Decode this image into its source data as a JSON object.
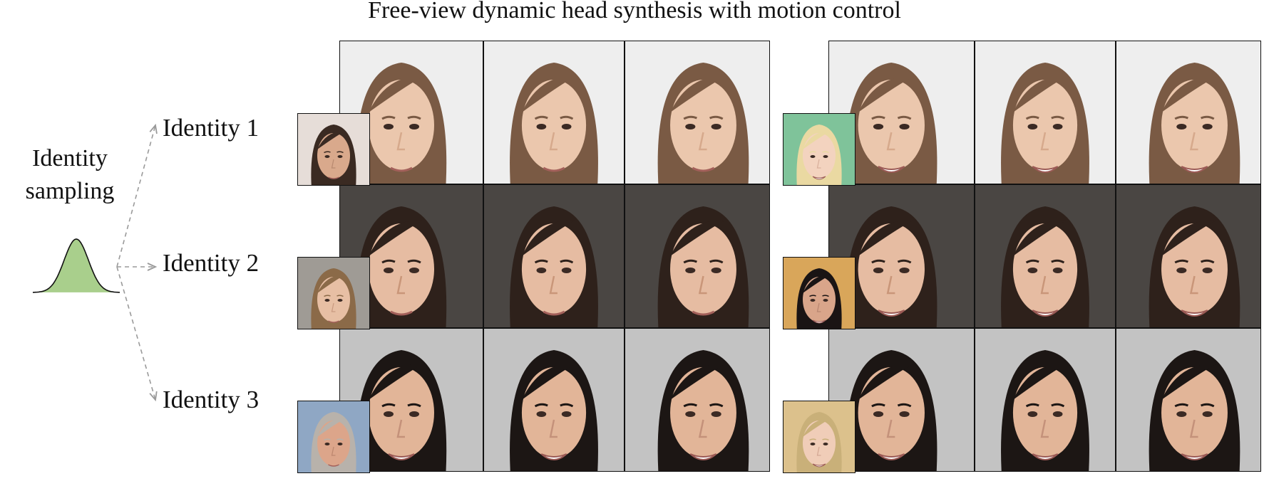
{
  "title": "Free-view dynamic head synthesis with motion control",
  "sampling": {
    "line1": "Identity",
    "line2": "sampling"
  },
  "identities": [
    {
      "label": "Identity 1"
    },
    {
      "label": "Identity 2"
    },
    {
      "label": "Identity 3"
    }
  ],
  "colors": {
    "gaussian_fill": "#a9cf8c",
    "arrow": "#9a9a9a",
    "border": "#111111",
    "identity_palettes": [
      {
        "bg": "#eeeeee",
        "hair": "#7a5a44",
        "skin": "#ebc7ad",
        "shade": "#d6a98c"
      },
      {
        "bg": "#4a4643",
        "hair": "#2e211b",
        "skin": "#e6bca2",
        "shade": "#c99679"
      },
      {
        "bg": "#c3c3c3",
        "hair": "#1c1614",
        "skin": "#e2b598",
        "shade": "#c4917a"
      }
    ],
    "driver_palettes_left": [
      {
        "bg": "#e6ddd8",
        "hair": "#3a2a22",
        "skin": "#d9a98c",
        "shade": "#b98a70"
      },
      {
        "bg": "#9f9b95",
        "hair": "#8b6a48",
        "skin": "#e7bfa4",
        "shade": "#c99a80"
      },
      {
        "bg": "#8fa7c4",
        "hair": "#b8b2ab",
        "skin": "#dca58a",
        "shade": "#bd876f"
      }
    ],
    "driver_palettes_right": [
      {
        "bg": "#7fc39a",
        "hair": "#ead9a2",
        "skin": "#f3d3bf",
        "shade": "#d9b09c"
      },
      {
        "bg": "#d9a65a",
        "hair": "#1a1414",
        "skin": "#d9a58a",
        "shade": "#b98671"
      },
      {
        "bg": "#dcc18c",
        "hair": "#c9b079",
        "skin": "#f0cdb8",
        "shade": "#d4a894"
      }
    ]
  }
}
